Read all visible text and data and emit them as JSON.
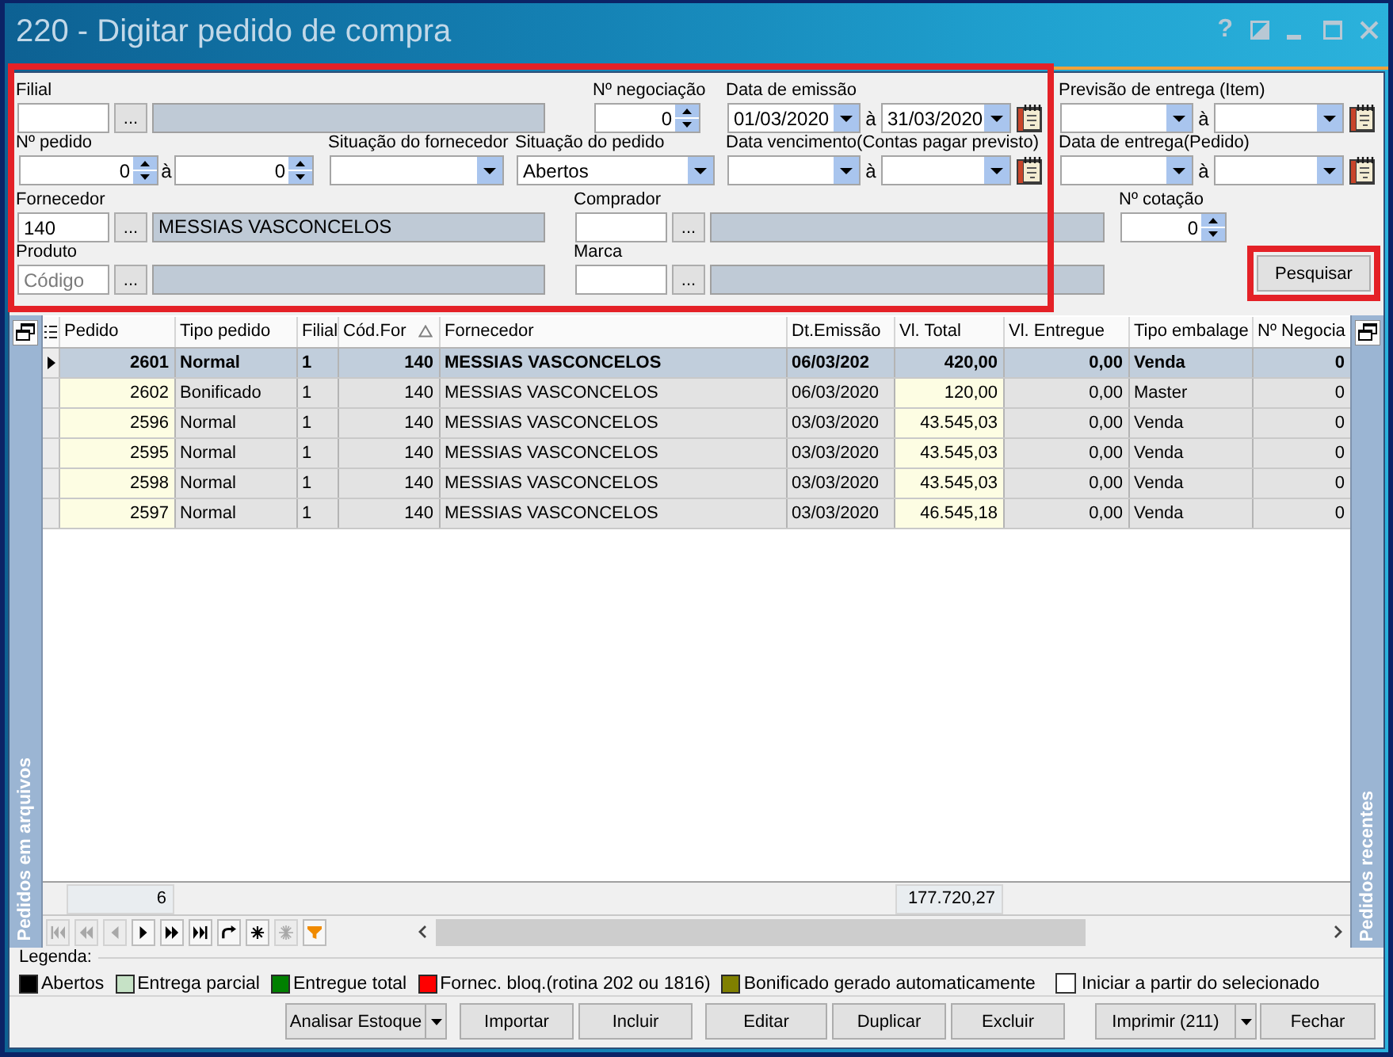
{
  "window": {
    "title": "220 - Digitar pedido de compra",
    "help": "?"
  },
  "filters": {
    "highlighted": true,
    "fields": [
      {
        "kind": "lookup",
        "label": "Filial",
        "button": "..."
      },
      {
        "kind": "spin",
        "label": "Nº negociação",
        "value": "0"
      },
      {
        "kind": "date_range",
        "label": "Data de emissão",
        "from": "01/03/2020",
        "separator": "à",
        "to": "31/03/2020"
      },
      {
        "kind": "date_range",
        "label": "Previsão de entrega (Item)",
        "separator": "à"
      },
      {
        "kind": "spin_range",
        "label": "Nº pedido",
        "from": "0",
        "separator": "à",
        "to": "0"
      },
      {
        "kind": "combo",
        "label": "Situação do fornecedor"
      },
      {
        "kind": "combo",
        "label": "Situação do pedido",
        "value": "Abertos"
      },
      {
        "kind": "date_range",
        "label": "Data vencimento(Contas pagar previsto)",
        "separator": "à"
      },
      {
        "kind": "date_range",
        "label": "Data de entrega(Pedido)",
        "separator": "à"
      },
      {
        "kind": "lookup",
        "label": "Fornecedor",
        "code": "140",
        "button": "...",
        "name": "MESSIAS VASCONCELOS"
      },
      {
        "kind": "lookup",
        "label": "Comprador",
        "button": "..."
      },
      {
        "kind": "spin",
        "label": "Nº cotação",
        "value": "0"
      },
      {
        "kind": "lookup",
        "label": "Produto",
        "placeholder": "Código",
        "button": "..."
      },
      {
        "kind": "lookup",
        "label": "Marca",
        "button": "..."
      }
    ]
  },
  "search_button": {
    "label": "Pesquisar",
    "highlighted": true
  },
  "left_panel": {
    "title": "Pedidos em arquivos"
  },
  "table": {
    "columns": [
      {
        "label": "Pedido",
        "sorted": false
      },
      {
        "label": "Tipo pedido",
        "sorted": false
      },
      {
        "label": "Filial",
        "sorted": false
      },
      {
        "label": "Cód.For",
        "sorted": true
      },
      {
        "label": "Fornecedor",
        "sorted": false
      },
      {
        "label": "Dt.Emissão",
        "sorted": false
      },
      {
        "label": "Vl. Total",
        "sorted": false
      },
      {
        "label": "Vl. Entregue",
        "sorted": false
      },
      {
        "label": "Tipo embalage",
        "sorted": false
      },
      {
        "label": "Nº Negocia",
        "sorted": false
      }
    ],
    "rows": [
      {
        "selected": true,
        "cells": [
          "2601",
          "Normal",
          "1",
          "140",
          "MESSIAS VASCONCELOS",
          "06/03/202",
          "420,00",
          "0,00",
          "Venda",
          "0"
        ]
      },
      {
        "selected": false,
        "cells": [
          "2602",
          "Bonificado",
          "1",
          "140",
          "MESSIAS VASCONCELOS",
          "06/03/2020",
          "120,00",
          "0,00",
          "Master",
          "0"
        ]
      },
      {
        "selected": false,
        "cells": [
          "2596",
          "Normal",
          "1",
          "140",
          "MESSIAS VASCONCELOS",
          "03/03/2020",
          "43.545,03",
          "0,00",
          "Venda",
          "0"
        ]
      },
      {
        "selected": false,
        "cells": [
          "2595",
          "Normal",
          "1",
          "140",
          "MESSIAS VASCONCELOS",
          "03/03/2020",
          "43.545,03",
          "0,00",
          "Venda",
          "0"
        ]
      },
      {
        "selected": false,
        "cells": [
          "2598",
          "Normal",
          "1",
          "140",
          "MESSIAS VASCONCELOS",
          "03/03/2020",
          "43.545,03",
          "0,00",
          "Venda",
          "0"
        ]
      },
      {
        "selected": false,
        "cells": [
          "2597",
          "Normal",
          "1",
          "140",
          "MESSIAS VASCONCELOS",
          "03/03/2020",
          "46.545,18",
          "0,00",
          "Venda",
          "0"
        ]
      }
    ],
    "summary": {
      "count": "6",
      "total": "177.720,27"
    },
    "navigator": [
      {
        "kind": "first",
        "disabled": true
      },
      {
        "kind": "prior_page",
        "disabled": true
      },
      {
        "kind": "prior",
        "disabled": true
      },
      {
        "kind": "next",
        "disabled": false
      },
      {
        "kind": "next_page",
        "disabled": false
      },
      {
        "kind": "last",
        "disabled": false
      },
      {
        "kind": "refresh",
        "disabled": false
      },
      {
        "kind": "insert",
        "disabled": false
      },
      {
        "kind": "cancel",
        "disabled": true
      },
      {
        "kind": "filter",
        "disabled": false
      }
    ]
  },
  "right_panel": {
    "title": "Pedidos recentes"
  },
  "legend": {
    "title": "Legenda:",
    "items": [
      {
        "label": "Abertos",
        "color": "#000000"
      },
      {
        "label": "Entrega parcial",
        "color": "#c6e2c6"
      },
      {
        "label": "Entregue total",
        "color": "#008000"
      },
      {
        "label": "Fornec. bloq.(rotina 202 ou 1816)",
        "color": "#ff0000"
      },
      {
        "label": "Bonificado gerado automaticamente",
        "color": "#808000"
      }
    ],
    "checkbox": {
      "label": "Iniciar a partir do selecionado",
      "checked": false
    }
  },
  "buttons": [
    {
      "label": "Analisar Estoque",
      "kind": "split"
    },
    {
      "label": "Importar",
      "kind": "plain"
    },
    {
      "label": "Incluir",
      "kind": "plain"
    },
    {
      "label": "Editar",
      "kind": "plain"
    },
    {
      "label": "Duplicar",
      "kind": "plain"
    },
    {
      "label": "Excluir",
      "kind": "plain"
    },
    {
      "label": "Imprimir (211)",
      "kind": "split"
    },
    {
      "label": "Fechar",
      "kind": "plain"
    }
  ]
}
